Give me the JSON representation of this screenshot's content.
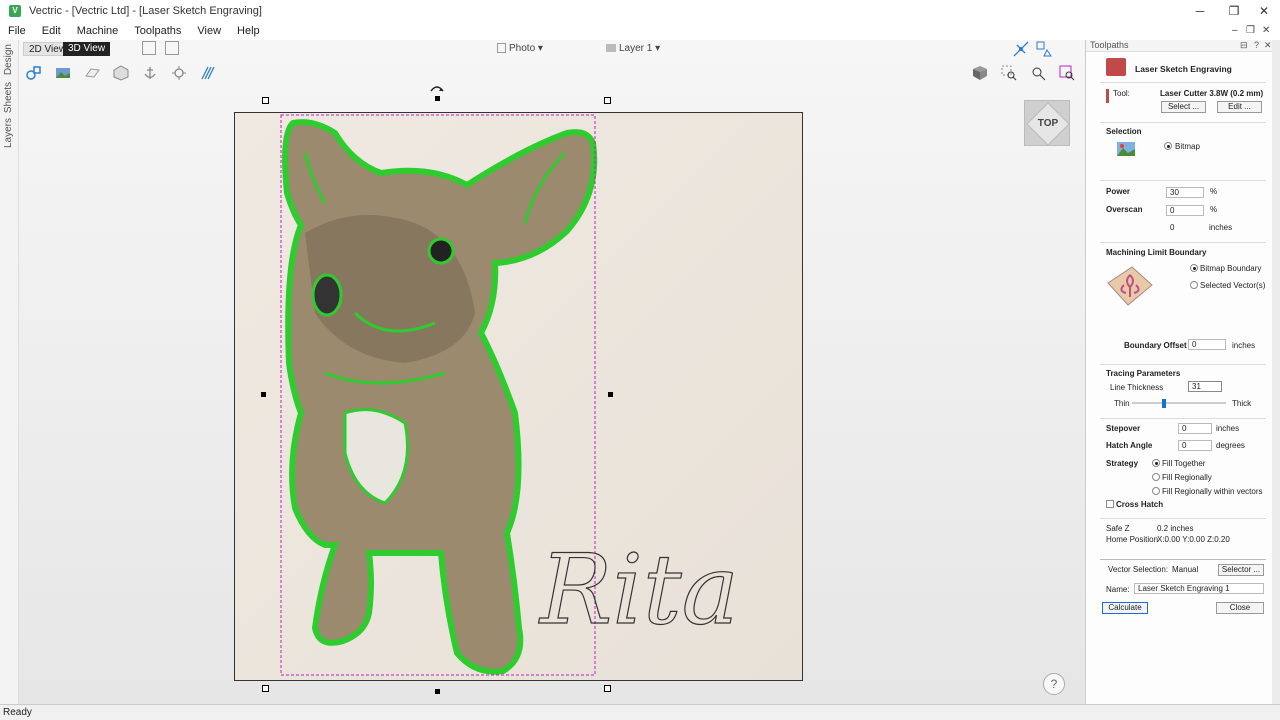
{
  "window": {
    "title": "Vectric - [Vectric Ltd] - [Laser Sketch Engraving]",
    "app_icon": "V"
  },
  "menu": [
    "File",
    "Edit",
    "Machine",
    "Toolpaths",
    "View",
    "Help"
  ],
  "view_tabs": {
    "two_d": "2D View",
    "three_d": "3D View"
  },
  "toolbar": {
    "photo_label": "Photo",
    "layer_label": "Layer 1"
  },
  "view_cube": {
    "label": "TOP"
  },
  "left_tabs": [
    "Design",
    "Sheets",
    "Layers"
  ],
  "canvas": {
    "engraving_text": "Rita"
  },
  "panel": {
    "header": "Toolpaths",
    "title": "Laser Sketch Engraving",
    "tool_label": "Tool:",
    "tool_name": "Laser Cutter 3.8W (0.2 mm)",
    "select_btn": "Select ...",
    "edit_btn": "Edit ...",
    "selection_heading": "Selection",
    "selection_bitmap": "Bitmap",
    "power_label": "Power",
    "power_value": "30",
    "power_unit": "%",
    "overscan_label": "Overscan",
    "overscan_value": "0",
    "overscan_unit": "%",
    "overscan_inches_value": "0",
    "overscan_inches_unit": "inches",
    "boundary_heading": "Machining Limit Boundary",
    "bitmap_boundary": "Bitmap Boundary",
    "selected_vectors": "Selected Vector(s)",
    "boundary_offset_label": "Boundary Offset",
    "boundary_offset_value": "0",
    "boundary_offset_unit": "inches",
    "tracing_heading": "Tracing Parameters",
    "line_thickness_label": "Line Thickness",
    "line_thickness_value": "31",
    "thin_label": "Thin",
    "thick_label": "Thick",
    "line_thickness_slider": 0.33,
    "stepover_label": "Stepover",
    "stepover_value": "0",
    "stepover_unit": "inches",
    "hatch_angle_label": "Hatch Angle",
    "hatch_angle_value": "0",
    "hatch_angle_unit": "degrees",
    "strategy_label": "Strategy",
    "strategy_options": [
      "Fill Together",
      "Fill Regionally",
      "Fill Regionally within vectors"
    ],
    "cross_hatch_label": "Cross Hatch",
    "safe_z_label": "Safe Z",
    "safe_z_value": "0.2 inches",
    "home_label": "Home Position",
    "home_value": "X:0.00 Y:0.00 Z:0.20",
    "vector_selection_label": "Vector Selection:",
    "vector_selection_value": "Manual",
    "selector_btn": "Selector ...",
    "name_label": "Name:",
    "name_value": "Laser Sketch Engraving 1",
    "calculate_btn": "Calculate",
    "close_btn": "Close"
  },
  "status": {
    "text": "Ready"
  },
  "colors": {
    "accent_green": "#2ecc2e",
    "selection_magenta": "#c020c0",
    "panel_bg": "#fdfdfd"
  }
}
